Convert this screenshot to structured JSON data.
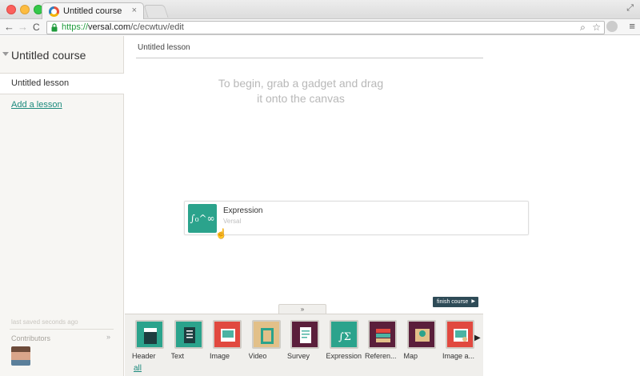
{
  "browser": {
    "tab_title": "Untitled course",
    "tab_close": "×",
    "url_scheme": "https://",
    "url_host": "versal.com",
    "url_path": "/c/ecwtuv/edit",
    "nav_back": "←",
    "nav_forward": "→",
    "nav_reload": "C",
    "search_icon": "⌕",
    "bookmark_icon": "☆",
    "menu_icon": "≡",
    "fullscreen_icon": "⤢"
  },
  "sidebar": {
    "course_title": "Untitled course",
    "lessons": [
      "Untitled lesson"
    ],
    "add_lesson": "Add a lesson",
    "saved_status": "last saved seconds ago",
    "contributors_label": "Contributors",
    "contributors_toggle": "»"
  },
  "canvas": {
    "lesson_title": "Untitled lesson",
    "hint": "To begin, grab a gadget and drag it onto the canvas",
    "dragging_gadget": {
      "name": "Expression",
      "source": "Versal",
      "icon": "∫₀^∞ Σ"
    }
  },
  "finish_button": "finish course",
  "tray": {
    "toggle_icon": "»",
    "all_link": "all",
    "next_icon": "▶",
    "gadgets": [
      {
        "label": "Header",
        "icon": "header-icon",
        "color": "#2ba38c"
      },
      {
        "label": "Text",
        "icon": "text-icon",
        "color": "#2ba38c"
      },
      {
        "label": "Image",
        "icon": "image-icon",
        "color": "#e1493f"
      },
      {
        "label": "Video",
        "icon": "video-icon",
        "color": "#e2c089"
      },
      {
        "label": "Survey",
        "icon": "survey-icon",
        "color": "#5b1f3b"
      },
      {
        "label": "Expression",
        "icon": "expression-icon",
        "color": "#2ba38c"
      },
      {
        "label": "Referen...",
        "icon": "reference-icon",
        "color": "#5b1f3b"
      },
      {
        "label": "Map",
        "icon": "map-icon",
        "color": "#5b1f3b"
      },
      {
        "label": "Image a...",
        "icon": "image-annotation-icon",
        "color": "#e1493f"
      }
    ]
  }
}
